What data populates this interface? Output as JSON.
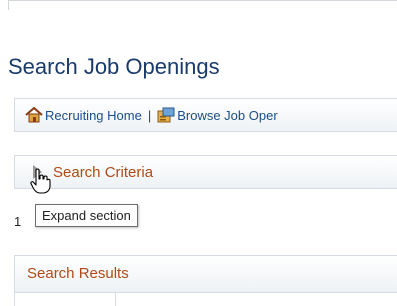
{
  "page": {
    "title": "Search Job Openings"
  },
  "links": [
    {
      "label": "Recruiting Home",
      "icon": "home-icon"
    },
    {
      "label": "Browse Job Oper",
      "icon": "browse-icon"
    }
  ],
  "separator": "|",
  "search_criteria": {
    "label": "Search Criteria",
    "state": "collapsed"
  },
  "tooltip": {
    "text": "Expand section"
  },
  "result_count_prefix": "1",
  "search_results": {
    "label": "Search Results"
  },
  "colors": {
    "title": "#1a3a6b",
    "section_title": "#b04a17",
    "link": "#1b4f8c"
  }
}
